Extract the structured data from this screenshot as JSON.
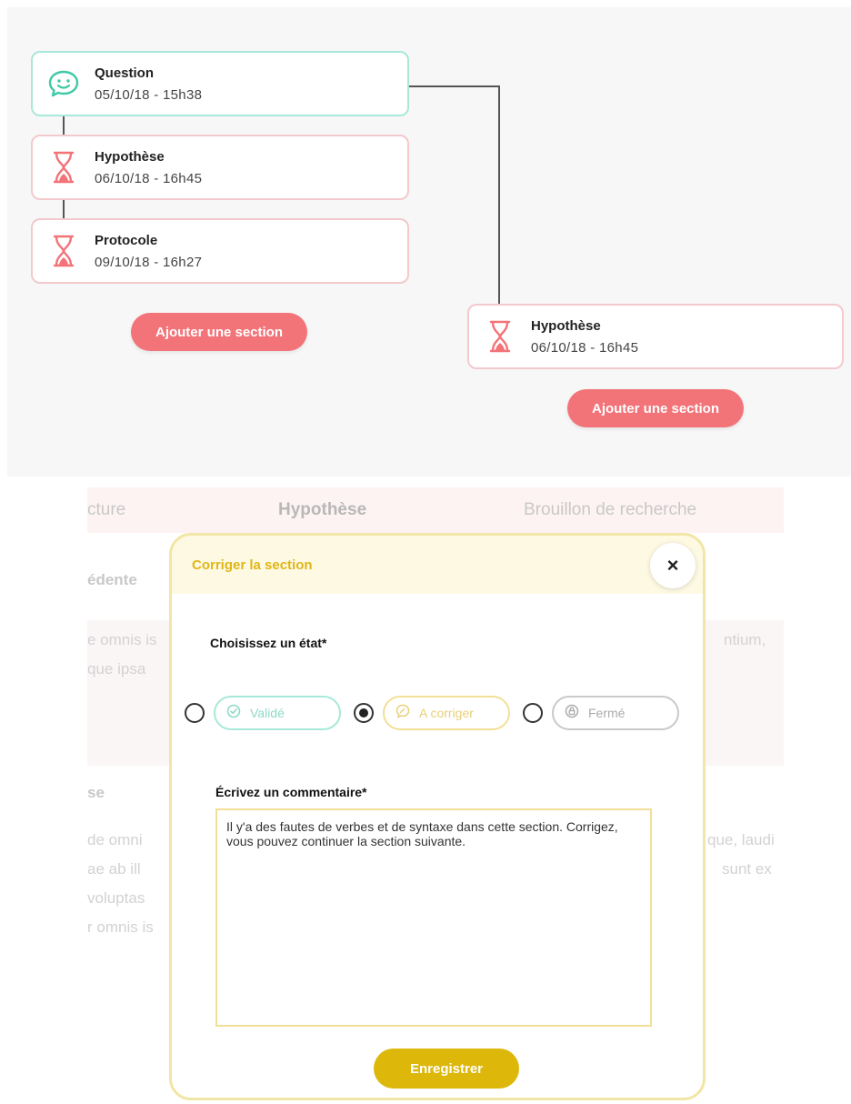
{
  "timeline": {
    "left_branch": [
      {
        "title": "Question",
        "date": "05/10/18 - 15h38",
        "icon": "chat-smile-icon"
      },
      {
        "title": "Hypothèse",
        "date": "06/10/18 - 16h45",
        "icon": "hourglass-icon"
      },
      {
        "title": "Protocole",
        "date": "09/10/18 - 16h27",
        "icon": "hourglass-icon"
      }
    ],
    "right_branch": [
      {
        "title": "Hypothèse",
        "date": "06/10/18 - 16h45",
        "icon": "hourglass-icon"
      }
    ],
    "add_section_label": "Ajouter une section",
    "colors": {
      "question_border": "#a8e8d9",
      "pending_border": "#f3c9cd",
      "button": "#f27378"
    }
  },
  "background": {
    "tabs": [
      "cture",
      "Hypothèse",
      "Brouillon de recherche"
    ],
    "fragments": [
      "édente",
      "e omnis is",
      "ntium,",
      "que ipsa",
      "se",
      "de omni",
      "que, laudi",
      "ae ab ill",
      "sunt ex",
      "voluptas",
      "r omnis is"
    ]
  },
  "modal": {
    "title": "Corriger la section",
    "close_glyph": "×",
    "state_label": "Choisissez un état*",
    "states": [
      {
        "label": "Validé",
        "icon": "check-circle-icon",
        "selected": false
      },
      {
        "label": "A corriger",
        "icon": "chat-edit-icon",
        "selected": true
      },
      {
        "label": "Fermé",
        "icon": "lock-circle-icon",
        "selected": false
      }
    ],
    "comment_label": "Écrivez un commentaire*",
    "comment_value": "Il y'a des fautes de verbes et de syntaxe dans cette section. Corrigez, vous pouvez continuer la section suivante.",
    "save_label": "Enregistrer",
    "colors": {
      "accent": "#ddb80b",
      "border": "#f2e6a6",
      "header_bg": "#fdf9e3"
    }
  }
}
